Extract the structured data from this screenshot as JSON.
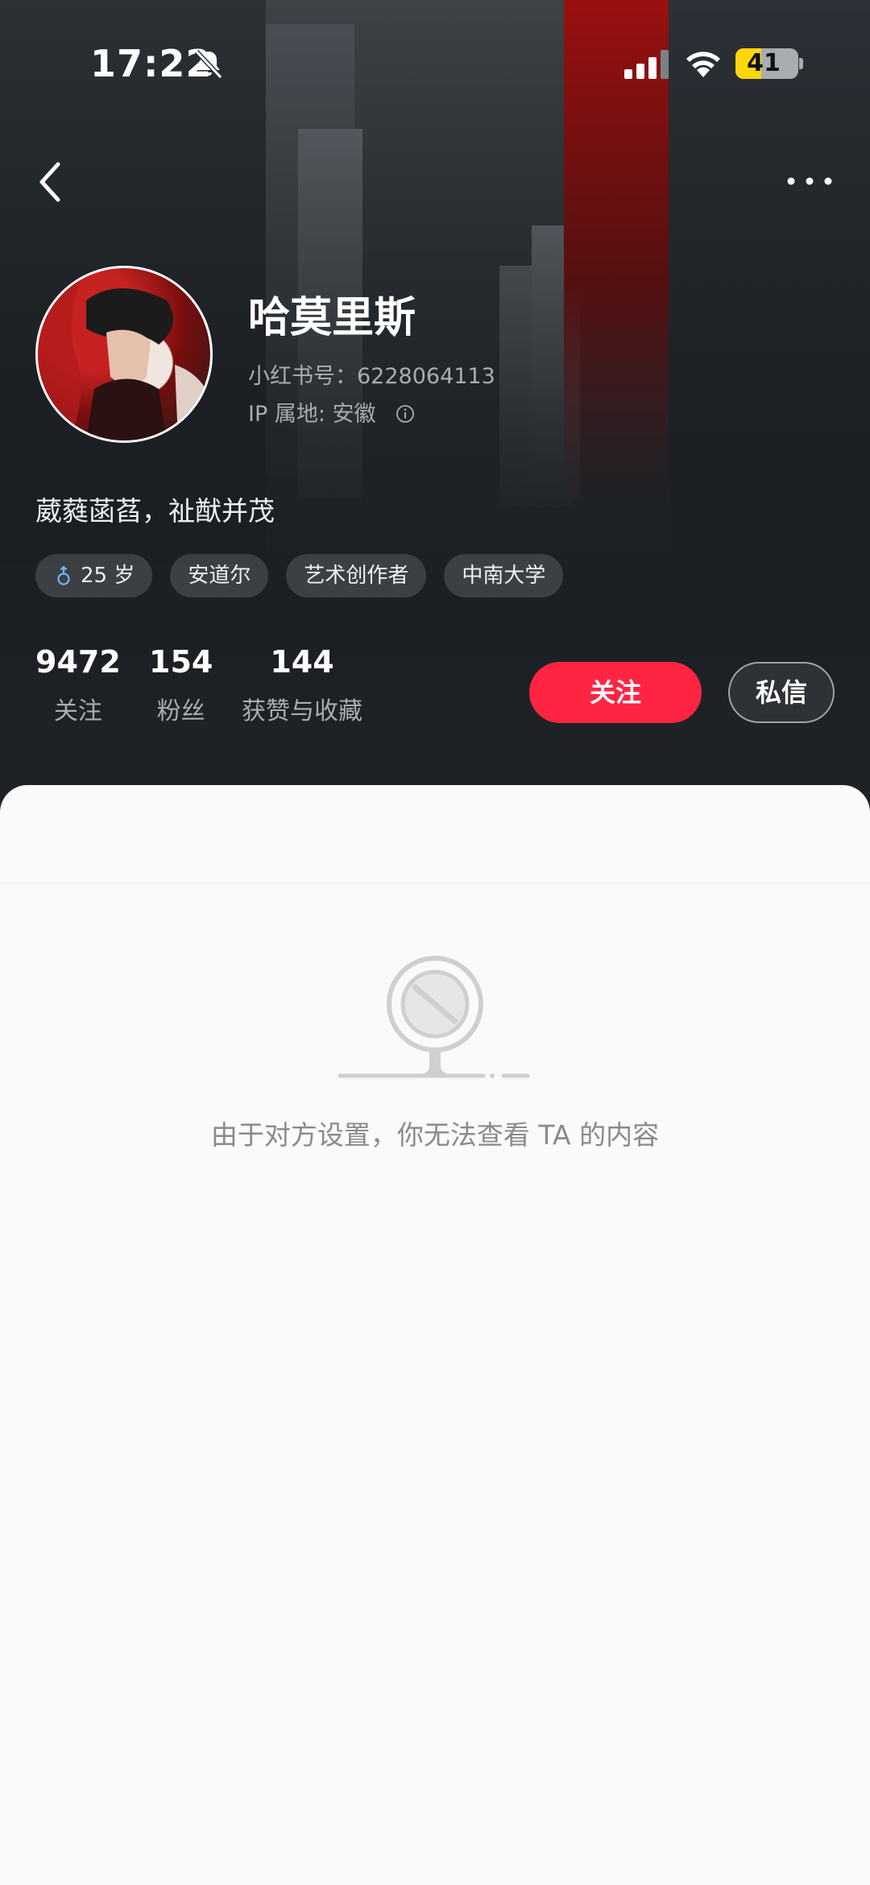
{
  "status_bar": {
    "time": "17:22",
    "battery": "41",
    "battery_level_percent": 41
  },
  "header": {
    "back_icon": "chevron-left-icon",
    "more_icon": "ellipsis-icon"
  },
  "profile": {
    "name": "哈莫里斯",
    "redid": "小红书号：6228064113",
    "ip": "IP 属地: 安徽",
    "bio": "葳蕤菡萏，祉猷并茂",
    "tags": [
      {
        "label": "25 岁",
        "icon": "male-icon"
      },
      {
        "label": "安道尔"
      },
      {
        "label": "艺术创作者"
      },
      {
        "label": "中南大学"
      }
    ],
    "stats": [
      {
        "value": "9472",
        "label": "关注"
      },
      {
        "value": "154",
        "label": "粉丝"
      },
      {
        "value": "144",
        "label": "获赞与收藏"
      }
    ],
    "follow_label": "关注",
    "message_label": "私信"
  },
  "colors": {
    "accent": "#ff2442",
    "battery": "#ffd60a"
  },
  "empty_state": {
    "icon": "blocked-icon",
    "text": "由于对方设置，你无法查看 TA 的内容"
  }
}
